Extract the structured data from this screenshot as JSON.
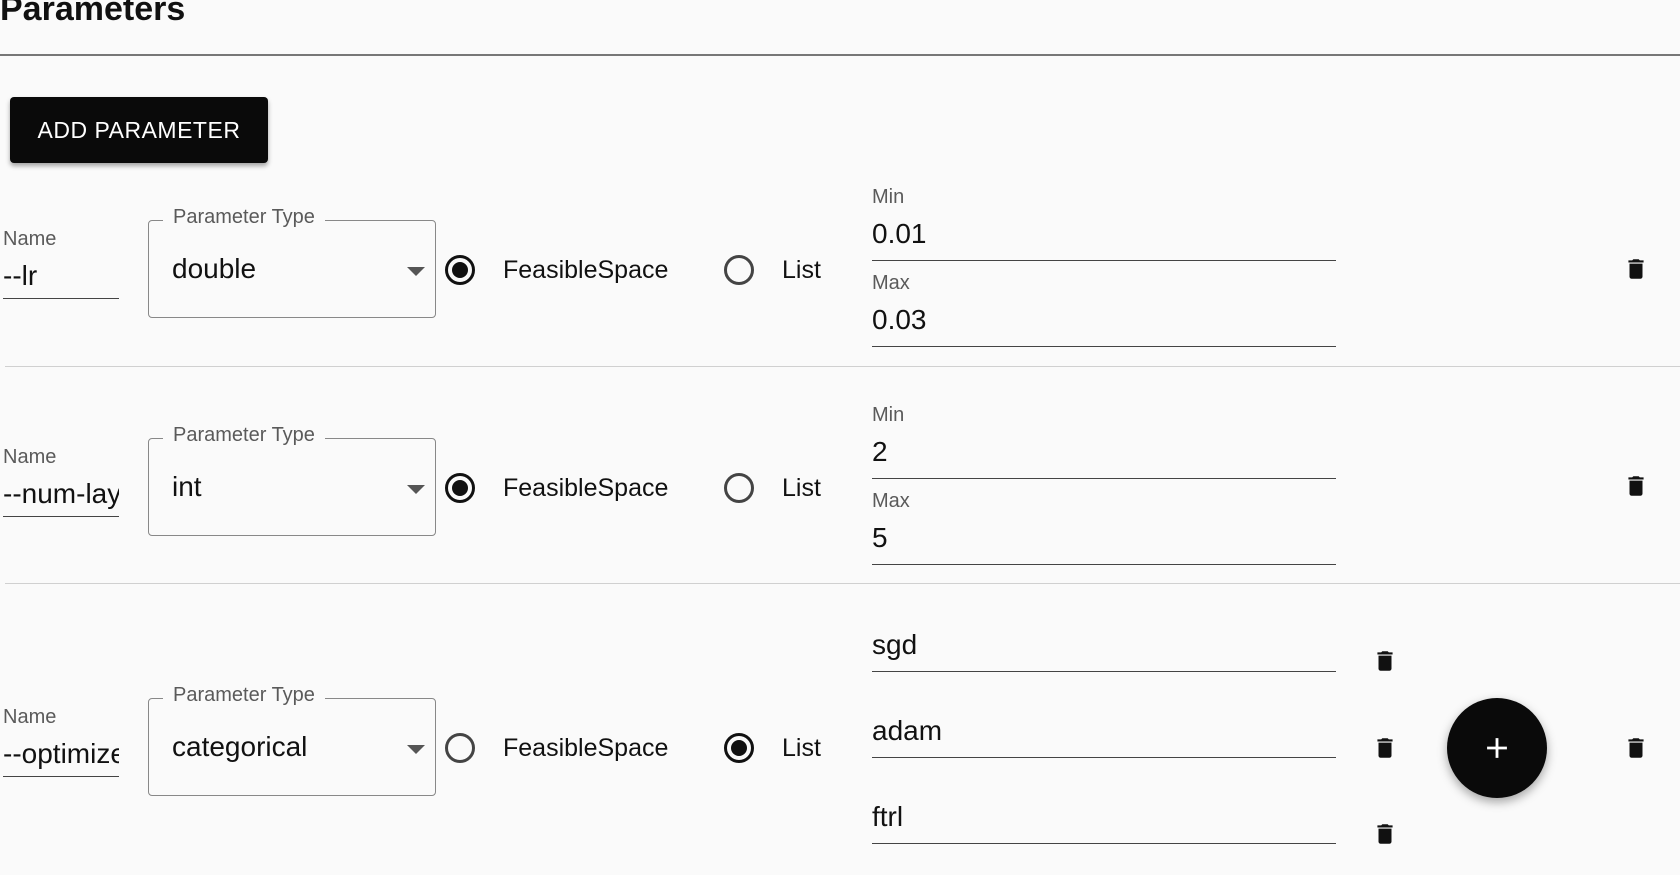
{
  "page": {
    "title": "Parameters"
  },
  "toolbar": {
    "add_label": "ADD PARAMETER"
  },
  "rows": [
    {
      "name_label": "Name",
      "name_value": "--lr",
      "type_label": "Parameter Type",
      "type_value": "double",
      "option_feasible": "FeasibleSpace",
      "option_list": "List",
      "selected": "FeasibleSpace",
      "min_label": "Min",
      "min_value": "0.01",
      "max_label": "Max",
      "max_value": "0.03"
    },
    {
      "name_label": "Name",
      "name_value": "--num-layers",
      "type_label": "Parameter Type",
      "type_value": "int",
      "option_feasible": "FeasibleSpace",
      "option_list": "List",
      "selected": "FeasibleSpace",
      "min_label": "Min",
      "min_value": "2",
      "max_label": "Max",
      "max_value": "5"
    },
    {
      "name_label": "Name",
      "name_value": "--optimizer",
      "type_label": "Parameter Type",
      "type_value": "categorical",
      "option_feasible": "FeasibleSpace",
      "option_list": "List",
      "selected": "List",
      "list_values": [
        "sgd",
        "adam",
        "ftrl"
      ]
    }
  ],
  "icons": {
    "delete": "trash-icon",
    "add": "plus-icon",
    "dropdown": "caret-down-icon"
  }
}
